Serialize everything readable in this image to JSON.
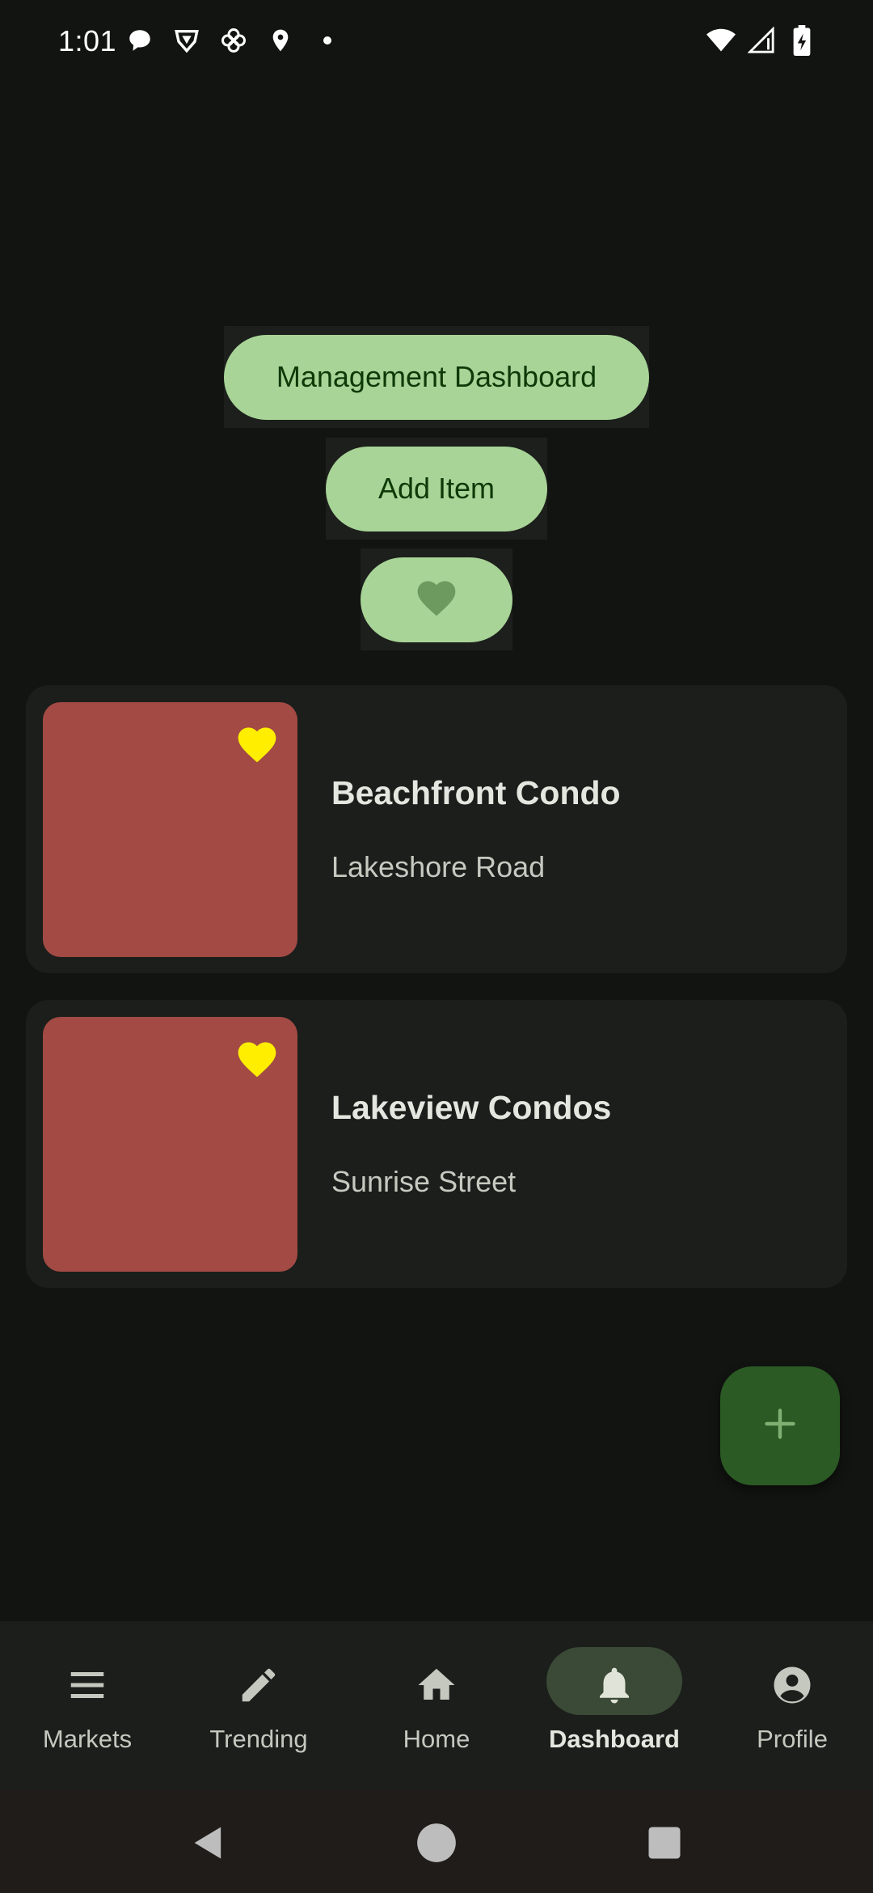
{
  "status_bar": {
    "time": "1:01",
    "left_icons": [
      "chat-bubble-icon",
      "vpn-shield-icon",
      "pinwheel-icon",
      "location-pin-icon",
      "dot-icon"
    ],
    "right_icons": [
      "wifi-icon",
      "signal-icon",
      "battery-charging-icon"
    ]
  },
  "actions": {
    "management_dashboard_label": "Management Dashboard",
    "add_item_label": "Add Item",
    "favorite_icon": "heart-icon"
  },
  "listings": [
    {
      "title": "Beachfront Condo",
      "subtitle": "Lakeshore Road",
      "favorite": true
    },
    {
      "title": "Lakeview Condos",
      "subtitle": "Sunrise Street",
      "favorite": true
    }
  ],
  "fab": {
    "icon": "plus-icon"
  },
  "bottom_nav": {
    "items": [
      {
        "label": "Markets",
        "icon": "menu-icon",
        "active": false
      },
      {
        "label": "Trending",
        "icon": "pencil-icon",
        "active": false
      },
      {
        "label": "Home",
        "icon": "home-icon",
        "active": false
      },
      {
        "label": "Dashboard",
        "icon": "bell-icon",
        "active": true
      },
      {
        "label": "Profile",
        "icon": "account-circle-icon",
        "active": false
      }
    ]
  },
  "colors": {
    "background": "#121411",
    "button": "#a8d497",
    "button_text": "#0d3a07",
    "card": "#1b1e1b",
    "thumb": "#a34a44",
    "heart": "#ffee00",
    "fab": "#2b5a24",
    "nav_indicator": "#3b4a36"
  }
}
